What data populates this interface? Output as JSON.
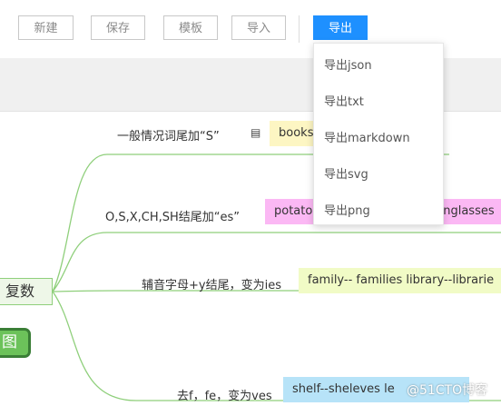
{
  "toolbar": {
    "new_label": "新建",
    "save_label": "保存",
    "template_label": "模板",
    "import_label": "导入",
    "export_label": "导出"
  },
  "export_menu": {
    "items": [
      "导出json",
      "导出txt",
      "导出markdown",
      "导出svg",
      "导出png"
    ]
  },
  "mindmap": {
    "root_label": "复数",
    "sub_node_label": "图",
    "branches": [
      {
        "label": "一般情况词尾加“S”",
        "tag": "books"
      },
      {
        "label": "O,S,X,CH,SH结尾加“es”",
        "tag": "potato",
        "tag_tail": "unglasses"
      },
      {
        "label": "辅音字母+y结尾，变为ies",
        "tag": "family-- families library--librarie"
      },
      {
        "label": "去f，fe，变为ves",
        "tag": "shelf--sheleves le"
      }
    ]
  },
  "watermark": "@51CTO博客",
  "colors": {
    "accent": "#1e90ff",
    "link_line": "#8fcf7b"
  },
  "icons": {
    "note": "note-icon"
  }
}
